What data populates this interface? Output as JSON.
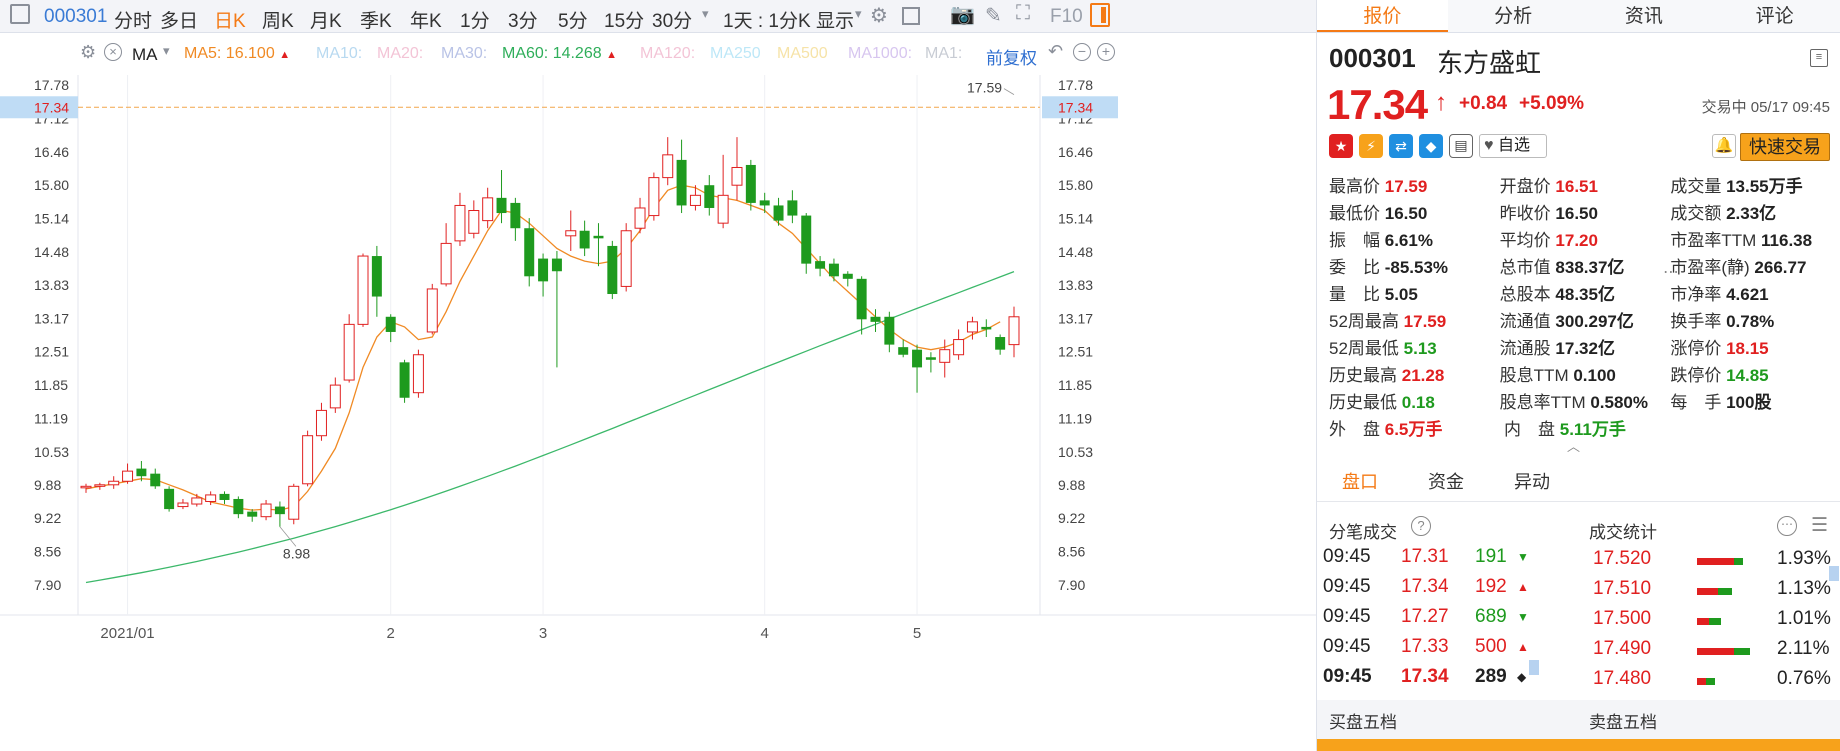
{
  "toolbar": {
    "code": "000301",
    "periods": [
      "分时",
      "多日",
      "日K",
      "周K",
      "月K",
      "季K",
      "年K",
      "1分",
      "3分",
      "5分",
      "15分",
      "30分"
    ],
    "active_period": "日K",
    "interval_select": "1天 : 1分K",
    "display_label": "显示",
    "f10_label": "F10"
  },
  "subbar": {
    "ma_label": "MA",
    "ma5": "MA5: 16.100",
    "ma10": "MA10:",
    "ma20": "MA20:",
    "ma30": "MA30:",
    "ma60": "MA60: 14.268",
    "ma120": "MA120:",
    "ma250": "MA250",
    "ma500": "MA500",
    "ma1000": "MA1000:",
    "ma1": "MA1:",
    "adjust": "前复权"
  },
  "chart_data": {
    "type": "candlestick",
    "y_ticks": [
      "17.78",
      "17.12",
      "16.46",
      "15.80",
      "15.14",
      "14.48",
      "13.83",
      "13.17",
      "12.51",
      "11.85",
      "11.19",
      "10.53",
      "9.88",
      "9.22",
      "8.56",
      "7.90"
    ],
    "y_range": [
      7.9,
      17.78
    ],
    "x_labels": [
      "2021/01",
      "2",
      "3",
      "4",
      "5"
    ],
    "x_label_days": [
      3,
      22,
      33,
      49,
      60
    ],
    "last_price_label": "17.34",
    "high_label": "17.59",
    "low_label": "8.98",
    "candles": [
      [
        9.82,
        9.85,
        9.72,
        9.9
      ],
      [
        9.85,
        9.88,
        9.78,
        9.92
      ],
      [
        9.88,
        9.95,
        9.8,
        10.05
      ],
      [
        9.95,
        10.15,
        9.9,
        10.3
      ],
      [
        10.2,
        10.05,
        9.95,
        10.35
      ],
      [
        10.1,
        9.85,
        9.8,
        10.2
      ],
      [
        9.8,
        9.4,
        9.35,
        9.85
      ],
      [
        9.45,
        9.52,
        9.4,
        9.6
      ],
      [
        9.5,
        9.62,
        9.45,
        9.7
      ],
      [
        9.55,
        9.68,
        9.48,
        9.75
      ],
      [
        9.7,
        9.58,
        9.5,
        9.75
      ],
      [
        9.6,
        9.3,
        9.22,
        9.65
      ],
      [
        9.35,
        9.25,
        9.15,
        9.4
      ],
      [
        9.25,
        9.5,
        9.18,
        9.58
      ],
      [
        9.45,
        9.3,
        9.05,
        9.55
      ],
      [
        9.2,
        9.85,
        9.1,
        9.9
      ],
      [
        9.9,
        10.85,
        9.85,
        10.95
      ],
      [
        10.85,
        11.35,
        10.75,
        11.5
      ],
      [
        11.4,
        11.85,
        11.3,
        12.0
      ],
      [
        11.95,
        13.05,
        11.9,
        13.25
      ],
      [
        13.05,
        14.4,
        13.0,
        14.45
      ],
      [
        14.4,
        13.6,
        13.2,
        14.6
      ],
      [
        13.2,
        12.9,
        12.7,
        13.25
      ],
      [
        12.3,
        11.6,
        11.5,
        12.35
      ],
      [
        11.7,
        12.45,
        11.6,
        12.55
      ],
      [
        12.9,
        13.75,
        12.85,
        13.85
      ],
      [
        13.85,
        14.65,
        13.8,
        15.05
      ],
      [
        14.7,
        15.4,
        14.6,
        15.65
      ],
      [
        14.85,
        15.3,
        14.75,
        15.5
      ],
      [
        15.1,
        15.55,
        14.95,
        15.75
      ],
      [
        15.55,
        15.25,
        15.05,
        16.1
      ],
      [
        15.45,
        14.95,
        14.7,
        15.55
      ],
      [
        14.95,
        14.0,
        13.8,
        15.15
      ],
      [
        14.35,
        13.9,
        13.6,
        14.45
      ],
      [
        14.35,
        14.1,
        12.2,
        14.5
      ],
      [
        14.8,
        14.9,
        14.5,
        15.3
      ],
      [
        14.9,
        14.55,
        14.4,
        15.1
      ],
      [
        14.8,
        14.75,
        14.2,
        15.05
      ],
      [
        14.6,
        13.65,
        13.55,
        14.7
      ],
      [
        13.8,
        14.9,
        13.7,
        15.05
      ],
      [
        14.95,
        15.35,
        14.85,
        15.55
      ],
      [
        15.2,
        15.95,
        15.1,
        16.05
      ],
      [
        15.95,
        16.4,
        15.8,
        16.75
      ],
      [
        16.3,
        15.4,
        15.25,
        16.7
      ],
      [
        15.4,
        15.6,
        15.3,
        15.8
      ],
      [
        15.8,
        15.35,
        15.2,
        16.0
      ],
      [
        15.05,
        15.6,
        14.95,
        16.4
      ],
      [
        15.8,
        16.15,
        15.5,
        16.75
      ],
      [
        16.2,
        15.45,
        15.3,
        16.3
      ],
      [
        15.5,
        15.4,
        15.25,
        15.65
      ],
      [
        15.4,
        15.1,
        15.0,
        15.55
      ],
      [
        15.5,
        15.2,
        15.05,
        15.7
      ],
      [
        15.2,
        14.25,
        14.05,
        15.25
      ],
      [
        14.3,
        14.15,
        14.0,
        14.4
      ],
      [
        14.25,
        14.0,
        13.9,
        14.35
      ],
      [
        14.05,
        13.95,
        13.8,
        14.1
      ],
      [
        13.95,
        13.15,
        12.85,
        14.0
      ],
      [
        13.2,
        13.1,
        12.9,
        13.35
      ],
      [
        13.2,
        12.65,
        12.5,
        13.3
      ],
      [
        12.6,
        12.45,
        12.4,
        12.75
      ],
      [
        12.55,
        12.2,
        11.7,
        12.65
      ],
      [
        12.4,
        12.35,
        12.1,
        12.5
      ],
      [
        12.3,
        12.55,
        12.0,
        12.75
      ],
      [
        12.45,
        12.75,
        12.35,
        12.95
      ],
      [
        12.9,
        13.1,
        12.75,
        13.2
      ],
      [
        13.0,
        12.95,
        12.8,
        13.15
      ],
      [
        12.8,
        12.55,
        12.45,
        12.85
      ],
      [
        12.65,
        13.2,
        12.4,
        13.4
      ]
    ],
    "ma5_line": [
      9.8,
      9.85,
      9.9,
      9.95,
      10.0,
      9.98,
      9.88,
      9.78,
      9.66,
      9.54,
      9.48,
      9.42,
      9.38,
      9.4,
      9.38,
      9.45,
      9.75,
      10.15,
      10.6,
      11.3,
      12.2,
      12.8,
      13.1,
      13.0,
      12.75,
      12.8,
      13.3,
      13.9,
      14.4,
      14.9,
      15.3,
      15.25,
      15.05,
      14.8,
      14.55,
      14.4,
      14.3,
      14.25,
      14.3,
      14.55,
      14.9,
      15.35,
      15.7,
      15.8,
      15.75,
      15.6,
      15.55,
      15.5,
      15.4,
      15.3,
      15.05,
      14.85,
      14.55,
      14.25,
      13.95,
      13.7,
      13.45,
      13.2,
      12.95,
      12.75,
      12.6,
      12.55,
      12.6,
      12.7,
      12.85,
      12.95,
      13.1
    ]
  },
  "right": {
    "tabs": [
      "报价",
      "分析",
      "资讯",
      "评论"
    ],
    "stock_code": "000301",
    "stock_name": "东方盛虹",
    "price": "17.34",
    "change": "+0.84",
    "change_pct": "+5.09%",
    "trade_status": "交易中 05/17 09:45",
    "watchlist_label": "自选",
    "fast_trade_label": "快速交易",
    "quote_rows": [
      [
        {
          "k": "最高价",
          "v": "17.59",
          "c": "red"
        },
        {
          "k": "开盘价",
          "v": "16.51",
          "c": "red"
        },
        {
          "k": "成交量",
          "v": "13.55万手",
          "c": "blk"
        }
      ],
      [
        {
          "k": "最低价",
          "v": "16.50",
          "c": "blk"
        },
        {
          "k": "昨收价",
          "v": "16.50",
          "c": "blk"
        },
        {
          "k": "成交额",
          "v": "2.33亿",
          "c": "blk"
        }
      ],
      [
        {
          "k": "振　幅",
          "v": "6.61%",
          "c": "blk"
        },
        {
          "k": "平均价",
          "v": "17.20",
          "c": "red"
        },
        {
          "k": "市盈率TTM",
          "v": "116.38",
          "c": "blk"
        }
      ],
      [
        {
          "k": "委　比",
          "v": "-85.53%",
          "c": "blk"
        },
        {
          "k": "总市值",
          "v": "838.37亿",
          "c": "blk"
        },
        {
          "k": "市盈率(静)",
          "v": "266.77",
          "c": "blk"
        }
      ],
      [
        {
          "k": "量　比",
          "v": "5.05",
          "c": "blk"
        },
        {
          "k": "总股本",
          "v": "48.35亿",
          "c": "blk"
        },
        {
          "k": "市净率",
          "v": "4.621",
          "c": "blk"
        }
      ],
      [
        {
          "k": "52周最高",
          "v": "17.59",
          "c": "red"
        },
        {
          "k": "流通值",
          "v": "300.297亿",
          "c": "blk"
        },
        {
          "k": "换手率",
          "v": "0.78%",
          "c": "blk"
        }
      ],
      [
        {
          "k": "52周最低",
          "v": "5.13",
          "c": "green"
        },
        {
          "k": "流通股",
          "v": "17.32亿",
          "c": "blk"
        },
        {
          "k": "涨停价",
          "v": "18.15",
          "c": "red"
        }
      ],
      [
        {
          "k": "历史最高",
          "v": "21.28",
          "c": "red"
        },
        {
          "k": "股息TTM",
          "v": "0.100",
          "c": "blk"
        },
        {
          "k": "跌停价",
          "v": "14.85",
          "c": "green"
        }
      ],
      [
        {
          "k": "历史最低",
          "v": "0.18",
          "c": "green"
        },
        {
          "k": "股息率TTM",
          "v": "0.580%",
          "c": "blk"
        },
        {
          "k": "每　手",
          "v": "100股",
          "c": "blk"
        }
      ],
      [
        {
          "k": "外　盘",
          "v": "6.5万手",
          "c": "red"
        },
        {
          "k": "内　盘",
          "v": "5.11万手",
          "c": "green"
        }
      ]
    ],
    "sub_tabs": [
      "盘口",
      "资金",
      "异动"
    ],
    "trades_title": "分笔成交",
    "stats_title": "成交统计",
    "trades": [
      {
        "t": "09:45",
        "p": "17.31",
        "v": "191",
        "d": "down"
      },
      {
        "t": "09:45",
        "p": "17.34",
        "v": "192",
        "d": "up"
      },
      {
        "t": "09:45",
        "p": "17.27",
        "v": "689",
        "d": "down"
      },
      {
        "t": "09:45",
        "p": "17.33",
        "v": "500",
        "d": "up"
      },
      {
        "t": "09:45",
        "p": "17.34",
        "v": "289",
        "d": "flat"
      }
    ],
    "stats": [
      {
        "p": "17.520",
        "pct": "1.93%",
        "r": 0.8,
        "g": 0.2
      },
      {
        "p": "17.510",
        "pct": "1.13%",
        "r": 0.45,
        "g": 0.3
      },
      {
        "p": "17.500",
        "pct": "1.01%",
        "r": 0.25,
        "g": 0.25
      },
      {
        "p": "17.490",
        "pct": "2.11%",
        "r": 0.8,
        "g": 0.35
      },
      {
        "p": "17.480",
        "pct": "0.76%",
        "r": 0.2,
        "g": 0.2
      }
    ],
    "bid_title": "买盘五档",
    "ask_title": "卖盘五档"
  }
}
